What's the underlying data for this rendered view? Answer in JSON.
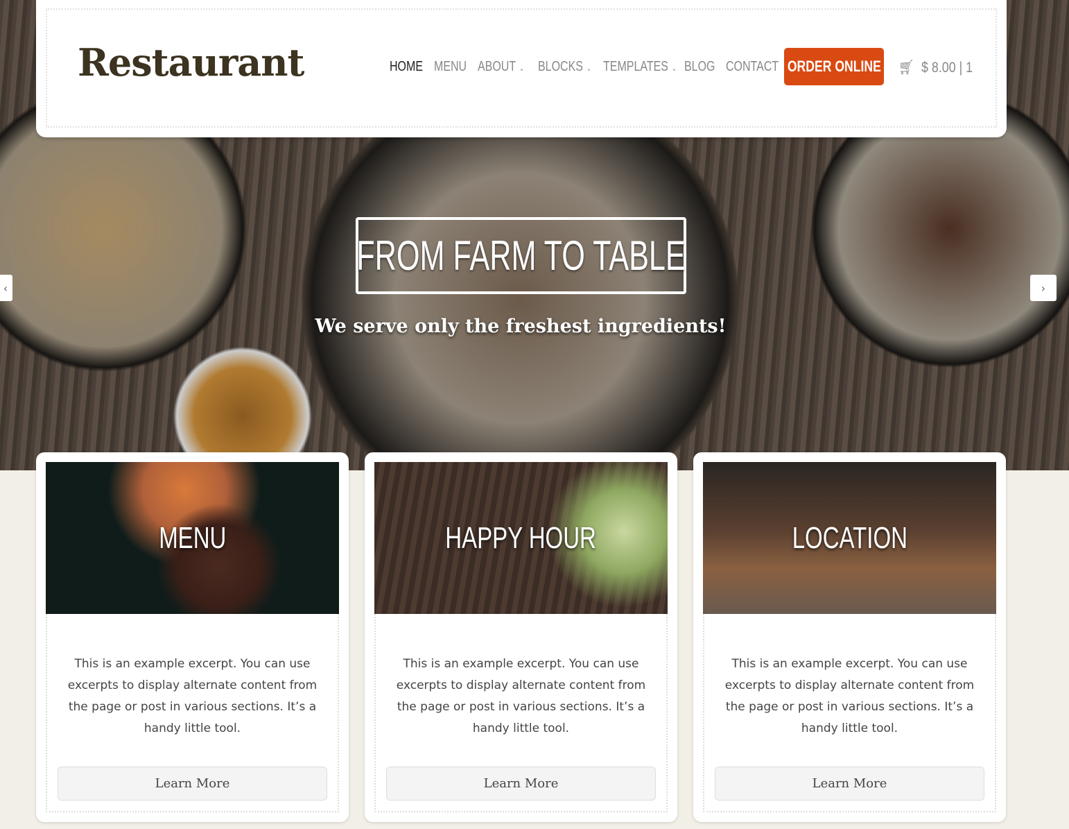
{
  "header": {
    "logo": "Restaurant",
    "nav": [
      {
        "label": "HOME"
      },
      {
        "label": "MENU"
      },
      {
        "label": "ABOUT",
        "dropdown": true
      },
      {
        "label": "BLOCKS",
        "dropdown": true
      },
      {
        "label": "TEMPLATES",
        "dropdown": true
      },
      {
        "label": "BLOG"
      },
      {
        "label": "CONTACT"
      }
    ],
    "order_button": "ORDER ONLINE",
    "cart": "$ 8.00 | 1",
    "accent": "#d94a12"
  },
  "hero": {
    "title": "FROM FARM TO TABLE",
    "subtitle": "We serve only the freshest ingredients!",
    "prev": "‹",
    "next": "›"
  },
  "cards": [
    {
      "title": "MENU",
      "excerpt": "This is an example excerpt. You can use excerpts to display alternate content from the page or post in various sections. It’s a handy little tool.",
      "button": "Learn More"
    },
    {
      "title": "HAPPY HOUR",
      "excerpt": "This is an example excerpt. You can use excerpts to display alternate content from the page or post in various sections. It’s a handy little tool.",
      "button": "Learn More"
    },
    {
      "title": "LOCATION",
      "excerpt": "This is an example excerpt. You can use excerpts to display alternate content from the page or post in various sections. It’s a handy little tool.",
      "button": "Learn More"
    }
  ]
}
